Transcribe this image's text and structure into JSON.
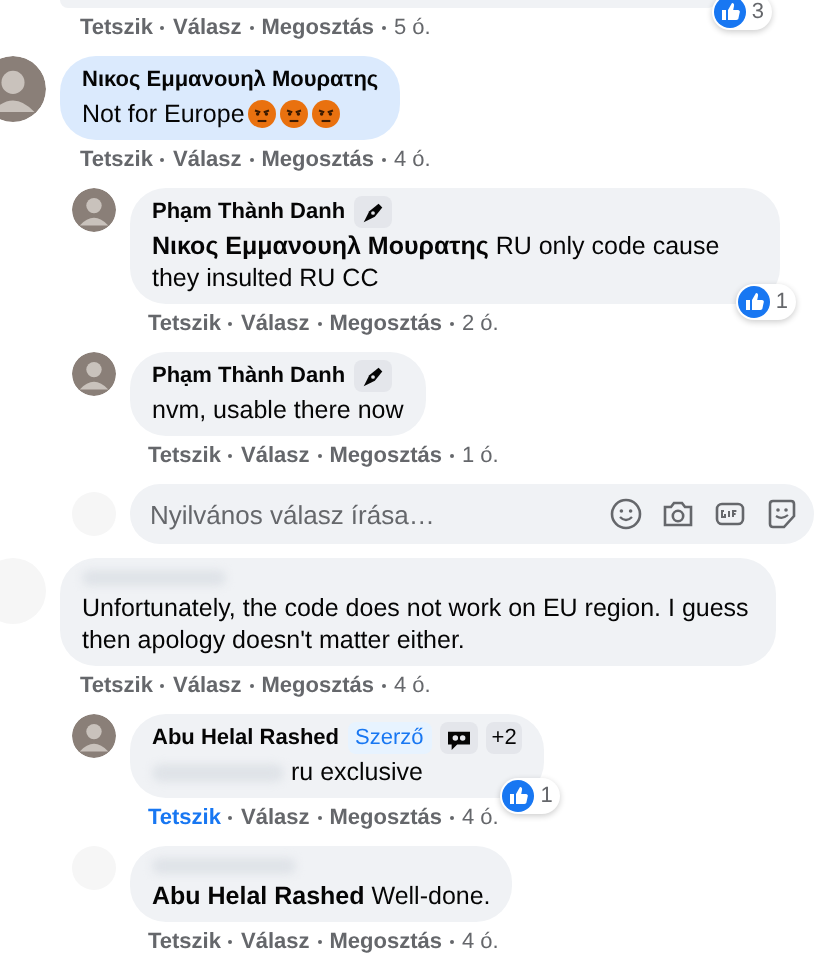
{
  "previous_comment": {
    "likes": "3",
    "actions": [
      "Tetszik",
      "Válasz",
      "Megosztás"
    ],
    "liked": false,
    "time": "5 ó."
  },
  "comments": [
    {
      "author": "Νικος Εμμανουηλ Μουρατης",
      "highlighted": true,
      "text": "Not for Europe",
      "reactions": [
        {
          "kind": "angry"
        },
        {
          "kind": "angry"
        },
        {
          "kind": "angry"
        }
      ],
      "actions": [
        "Tetszik",
        "Válasz",
        "Megosztás"
      ],
      "liked": false,
      "time": "4 ó.",
      "replies": [
        {
          "author": "Phạm Thành Danh",
          "highlighted": false,
          "badges": [
            {
              "kind": "pen"
            }
          ],
          "text": "**Νικος Εμμανουηλ Μουρατης** RU only code cause they insulted RU CC",
          "likes": "1",
          "actions": [
            "Tetszik",
            "Válasz",
            "Megosztás"
          ],
          "liked": false,
          "time": "2 ó."
        },
        {
          "author": "Phạm Thành Danh",
          "highlighted": false,
          "badges": [
            {
              "kind": "pen"
            }
          ],
          "text": "nvm, usable there now",
          "actions": [
            "Tetszik",
            "Válasz",
            "Megosztás"
          ],
          "liked": false,
          "time": "1 ó."
        }
      ],
      "reply_box": {
        "placeholder": "Nyilvános válasz írása…"
      }
    },
    {
      "highlighted": false,
      "text": "Unfortunately, the code does not work on EU region. I guess then apology doesn't matter either.",
      "actions": [
        "Tetszik",
        "Válasz",
        "Megosztás"
      ],
      "liked": false,
      "time": "4 ó.",
      "replies": [
        {
          "author": "Abu Helal Rashed",
          "highlighted": false,
          "badges": [
            {
              "kind": "author",
              "text": "Szerző"
            },
            {
              "kind": "cloud"
            },
            {
              "kind": "count",
              "text": "+2"
            }
          ],
          "mention_redacted": true,
          "text": "ru exclusive",
          "likes": "1",
          "actions": [
            "Tetszik",
            "Válasz",
            "Megosztás"
          ],
          "liked": true,
          "time": "4 ó."
        },
        {
          "highlighted": false,
          "mention_redacted": false,
          "text": "**Abu Helal Rashed** Well-done.",
          "actions": [
            "Tetszik",
            "Válasz",
            "Megosztás"
          ],
          "liked": false,
          "time": "4 ó."
        }
      ]
    }
  ]
}
